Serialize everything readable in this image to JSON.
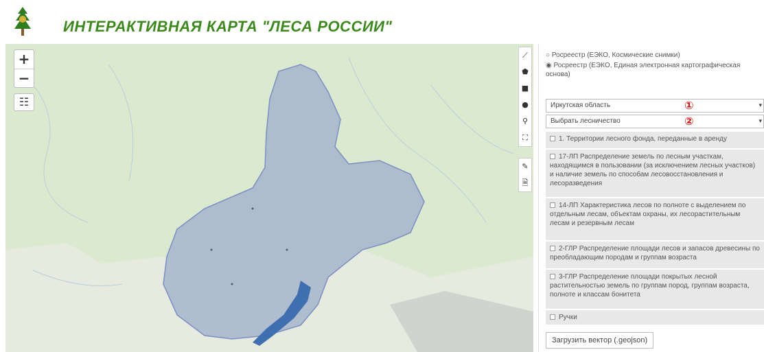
{
  "header": {
    "title": "ИНТЕРАКТИВНАЯ КАРТА \"ЛЕСА РОССИИ\""
  },
  "map": {
    "zoom_in": "+",
    "zoom_out": "−",
    "layers_icon": "☷",
    "tools": [
      "⟋",
      "⬟",
      "■",
      "●",
      "⚲",
      "⛶"
    ],
    "tools2": [
      "✎",
      "🗎"
    ],
    "colors": {
      "region_fill": "#a9b8cc",
      "region_stroke": "#7a8fc4",
      "water": "#3f6fb0"
    }
  },
  "panel": {
    "radio1": "Росреестр (ЕЭКО, Космические снимки)",
    "radio2": "Росреестр (ЕЭКО, Единая электронная картографическая основа)",
    "select_region": "Иркутская область",
    "select_forestry": "Выбрать лесничество",
    "marker1": "①",
    "marker2": "②",
    "layers": [
      "1. Территории лесного фонда, переданные в аренду",
      "17-ЛП Распределение земель по лесным участкам, находящимся в пользовании (за исключением лесных участков) и наличие земель по способам лесовосстановления и лесоразведения",
      "14-ЛП Характеристика лесов по полноте с выделением по отдельным лесам, объектам охраны, их лесорастительным лесам и резервным лесам",
      "2-ГЛР Распределение площади лесов и запасов древесины по преобладающим породам и группам возраста",
      "3-ГЛР Распределение площади покрытых лесной растительностью земель по группам пород, группам возраста, полноте и классам бонитета",
      "Ручки"
    ],
    "upload_button": "Загрузить вектор (.geojson)"
  }
}
